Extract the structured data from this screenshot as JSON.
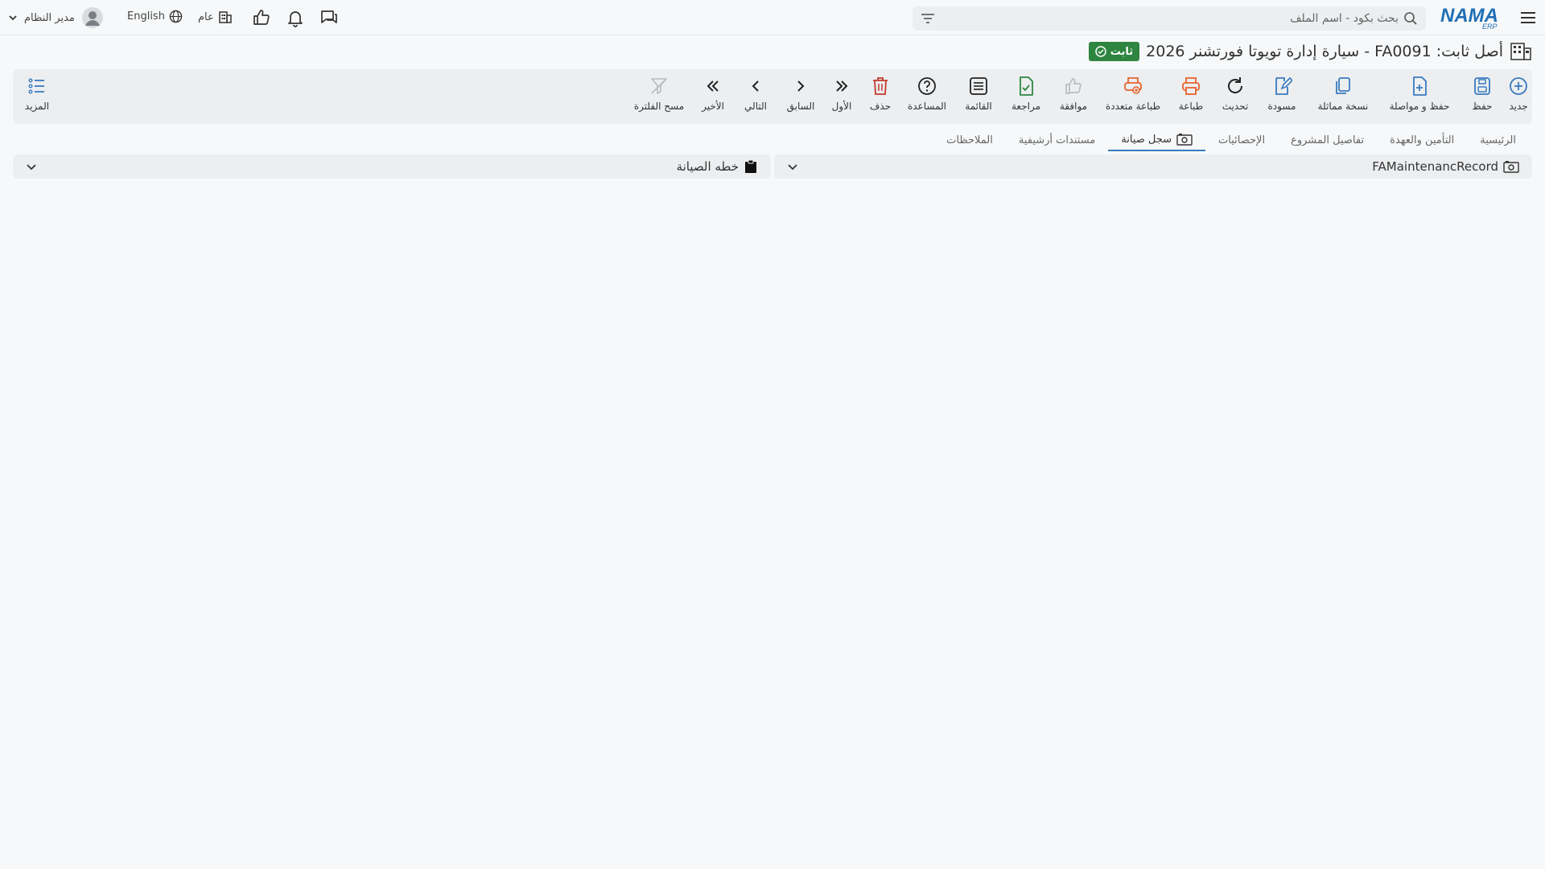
{
  "topbar": {
    "search_placeholder": "بحث بكود - اسم الملف",
    "user_name": "مدير النظام",
    "language": "English",
    "branch": "عام",
    "logo_text": "NAMA",
    "logo_sub": "ERP"
  },
  "record": {
    "title": "أصل ثابت: FA0091 - سيارة إدارة تويوتا فورتشنر 2026",
    "status": "ثابت"
  },
  "toolbar": {
    "new": "جديد",
    "save": "حفظ",
    "save_continue": "حفظ و مواصلة",
    "duplicate": "نسخة مماثلة",
    "draft": "مسودة",
    "refresh": "تحديث",
    "print": "طباعة",
    "multi_print": "طباعة متعددة",
    "approve": "موافقة",
    "review": "مراجعة",
    "list": "القائمة",
    "help": "المساعدة",
    "delete": "حذف",
    "first": "الأول",
    "previous": "السابق",
    "next": "التالي",
    "last": "الأخير",
    "clear_filter": "مسح الفلترة",
    "more": "المزيد"
  },
  "tabs": [
    {
      "label": "الرئيسية"
    },
    {
      "label": "التأمين والعهدة"
    },
    {
      "label": "تفاصيل المشروع"
    },
    {
      "label": "الإحصائيات"
    },
    {
      "label": "سجل صيانة"
    },
    {
      "label": "مستندات أرشيفية"
    },
    {
      "label": "الملاحظات"
    }
  ],
  "panels": {
    "right": "FAMaintenancRecord",
    "left": "خطه الصيانة"
  },
  "colors": {
    "accent": "#3a7bbf",
    "status_green": "#2e8540",
    "print_orange": "#e8622c",
    "delete_red": "#c0392b",
    "review_green": "#2e8540"
  }
}
